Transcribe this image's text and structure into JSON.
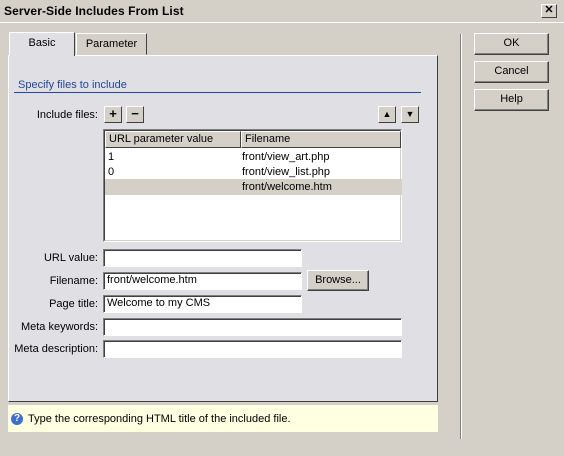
{
  "window": {
    "title": "Server-Side Includes From List",
    "close_glyph": "✕"
  },
  "tabs": [
    {
      "label": "Basic",
      "active": true
    },
    {
      "label": "Parameter",
      "active": false
    }
  ],
  "section": {
    "title": "Specify files to include"
  },
  "include_files": {
    "label": "Include files:",
    "add_glyph": "+",
    "remove_glyph": "−",
    "up_glyph": "▲",
    "down_glyph": "▼",
    "columns": [
      "URL parameter value",
      "Filename"
    ],
    "rows": [
      {
        "param": "1",
        "filename": "front/view_art.php",
        "selected": false
      },
      {
        "param": "0",
        "filename": "front/view_list.php",
        "selected": false
      },
      {
        "param": "",
        "filename": "front/welcome.htm",
        "selected": true
      }
    ]
  },
  "form": {
    "url_value_label": "URL value:",
    "url_value": "",
    "filename_label": "Filename:",
    "filename": "front/welcome.htm",
    "browse_label": "Browse...",
    "page_title_label": "Page title:",
    "page_title": "Welcome to my CMS",
    "meta_keywords_label": "Meta keywords:",
    "meta_keywords": "",
    "meta_description_label": "Meta description:",
    "meta_description": ""
  },
  "hint": {
    "icon": "help-icon",
    "text": "Type the corresponding HTML title of the included file."
  },
  "buttons": {
    "ok": "OK",
    "cancel": "Cancel",
    "help": "Help"
  },
  "colors": {
    "section_title": "#23479a",
    "hint_background": "#ffffe1",
    "dialog_background": "#d4d0c8"
  }
}
